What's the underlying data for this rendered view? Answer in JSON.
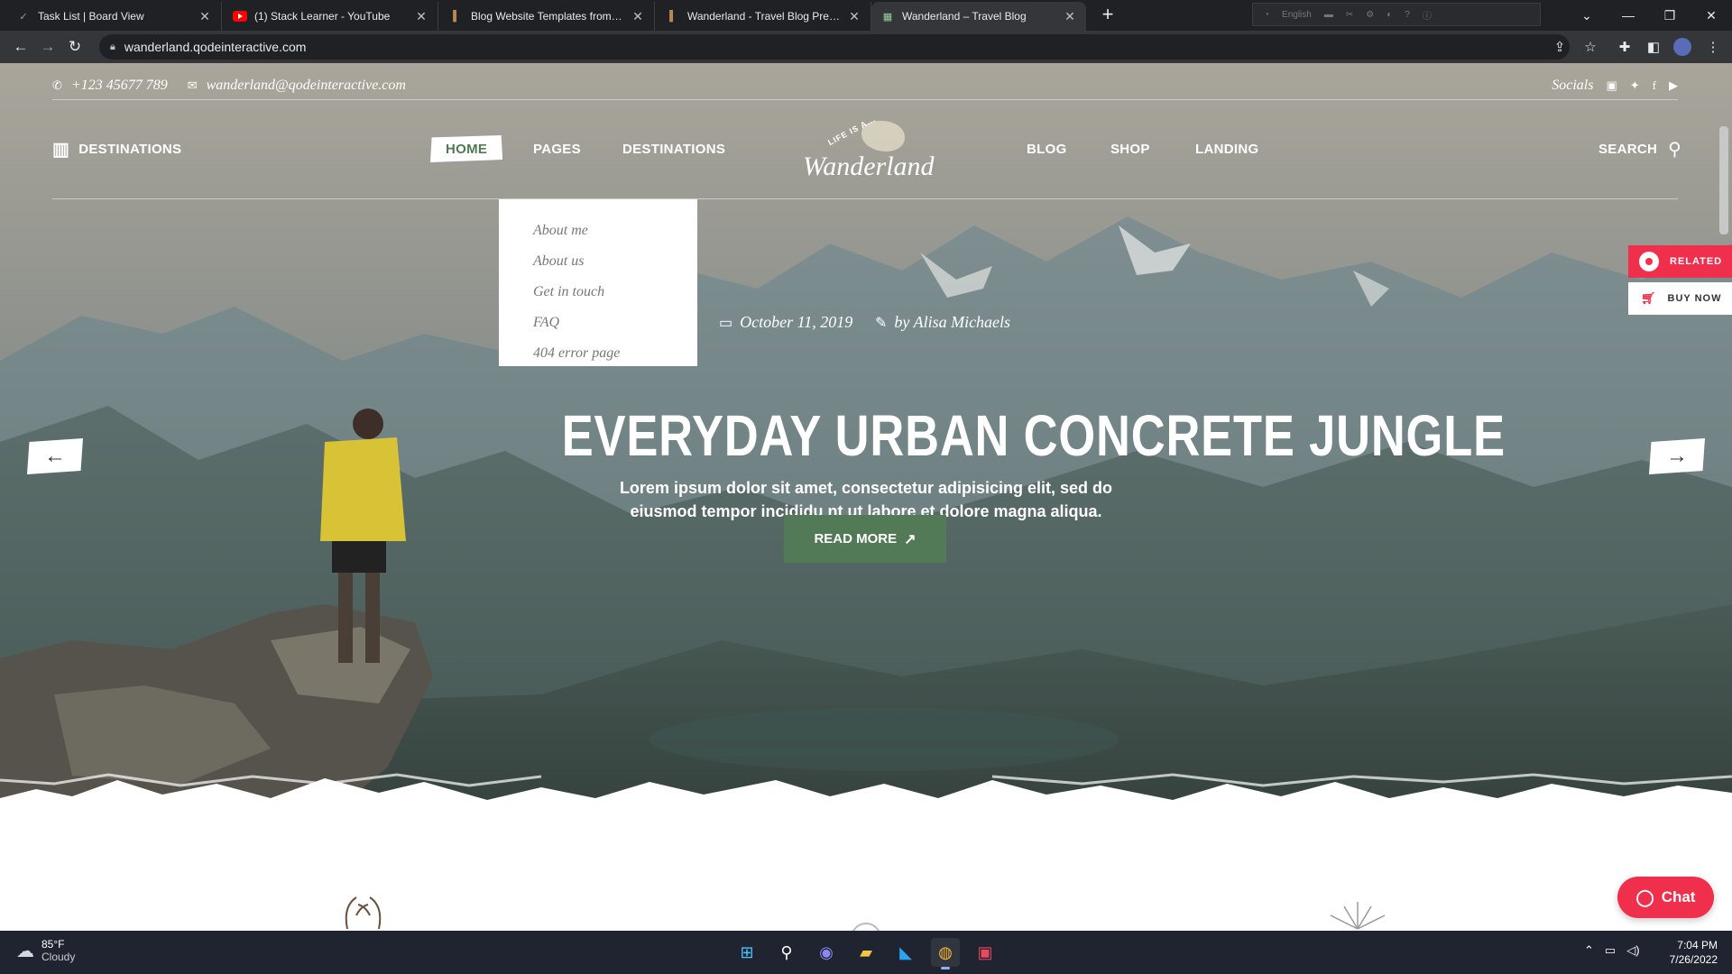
{
  "browser": {
    "tabs": [
      {
        "title": "Task List | Board View",
        "icon": "checkmark-icon"
      },
      {
        "title": "(1) Stack Learner - YouTube",
        "icon": "youtube-icon"
      },
      {
        "title": "Blog Website Templates from Th",
        "icon": "book-icon"
      },
      {
        "title": "Wanderland - Travel Blog Previe",
        "icon": "book-icon"
      },
      {
        "title": "Wanderland – Travel Blog",
        "icon": "wanderland-favicon",
        "active": true
      }
    ],
    "address": "wanderland.qodeinteractive.com",
    "mini_label": "English"
  },
  "site": {
    "phone": "+123 45677 789",
    "email": "wanderland@qodeinteractive.com",
    "socials_label": "Socials",
    "destinations_label": "DESTINATIONS",
    "nav": [
      "HOME",
      "PAGES",
      "DESTINATIONS",
      "BLOG",
      "SHOP",
      "LANDING"
    ],
    "search_label": "SEARCH",
    "logo": {
      "tagline": "LIFE IS A...",
      "name": "Wanderland"
    },
    "pages_menu": [
      "About me",
      "About us",
      "Get in touch",
      "FAQ",
      "404 error page"
    ],
    "post": {
      "date": "October 11, 2019",
      "author": "by Alisa Michaels",
      "title": "EVERYDAY URBAN CONCRETE JUNGLE",
      "lead_line1": "Lorem ipsum dolor sit amet, consectetur adipisicing elit, sed do",
      "lead_line2": "eiusmod tempor incididu nt ut labore et dolore magna aliqua.",
      "cta": "READ MORE"
    },
    "related_label": "RELATED",
    "buy_label": "BUY NOW",
    "chat_label": "Chat",
    "accent": "#537a56",
    "red": "#ef2f4b"
  },
  "taskbar": {
    "temp": "85°F",
    "condition": "Cloudy",
    "time": "7:04 PM",
    "date": "7/26/2022"
  }
}
